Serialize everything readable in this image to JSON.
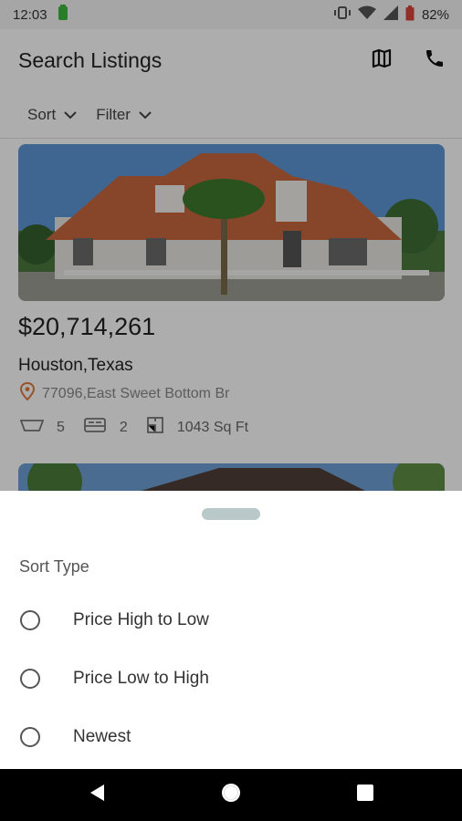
{
  "status_bar": {
    "time": "12:03",
    "battery": "82%"
  },
  "app_bar": {
    "title": "Search Listings",
    "map_icon": "map-icon",
    "phone_icon": "phone-icon"
  },
  "filters": {
    "sort_label": "Sort",
    "filter_label": "Filter"
  },
  "listing": {
    "price": "$20,714,261",
    "city": "Houston,Texas",
    "address": "77096,East Sweet Bottom Br",
    "beds": "5",
    "baths": "2",
    "area": "1043 Sq Ft"
  },
  "sheet": {
    "title": "Sort Type",
    "options": [
      "Price High to Low",
      "Price Low to High",
      "Newest"
    ],
    "selected": null
  },
  "colors": {
    "accent_pin": "#e07a3a",
    "scrim": "rgba(0,0,0,0.32)"
  }
}
